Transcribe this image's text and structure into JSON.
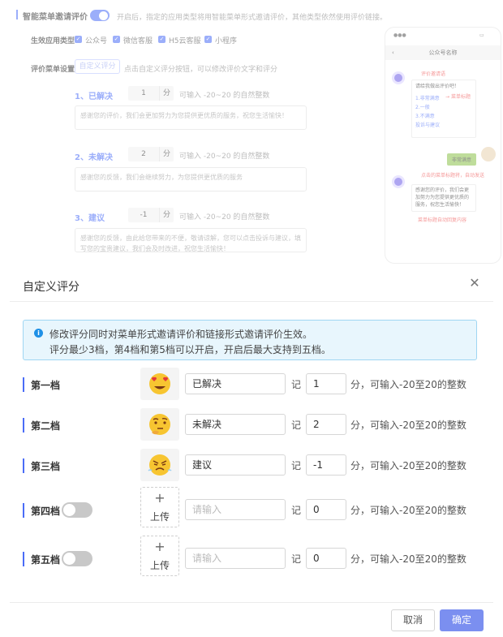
{
  "background_page": {
    "title": "智能菜单邀请评价",
    "title_hint": "开启后，指定的应用类型将用智能菜单形式邀请评价，其他类型依然使用评价链接。",
    "app_types_label": "生效应用类型",
    "app_types": [
      "公众号",
      "微信客服",
      "H5云客服",
      "小程序"
    ],
    "menu_settings_label": "评价菜单设置",
    "custom_score_button": "自定义评分",
    "custom_score_hint": "点击自定义评分按钮，可以修改评价文字和评分",
    "levels": [
      {
        "title": "1、已解决",
        "score": "1",
        "unit": "分",
        "hint": "可输入 -20~20 的自然整数",
        "message": "感谢您的评价，我们会更加努力为您提供更优质的服务，祝您生活愉快！"
      },
      {
        "title": "2、未解决",
        "score": "2",
        "unit": "分",
        "hint": "可输入 -20~20 的自然整数",
        "message": "感谢您的反馈，我们会继续努力，为您提供更优质的服务"
      },
      {
        "title": "3、建议",
        "score": "-1",
        "unit": "分",
        "hint": "可输入 -20~20 的自然整数",
        "message": "感谢您的反馈，由此给您带来的不便，敬请谅解，您可以点击投诉与建议，填写您的宝贵建议，我们会及时改进，祝您生活愉快！"
      }
    ],
    "phone": {
      "header": "公众号名称",
      "invite_label": "评价邀请语",
      "invite_text": "请给我做出评价吧！",
      "menu_title_label": "菜单标题",
      "options": [
        "1.非常满意",
        "2.一般",
        "3.不满意",
        "投诉与建议"
      ],
      "user_reply": "非常满意",
      "auto_send_note": "点击的菜单标题将，自动发送",
      "reply_text": "感谢您的评价，我们会更加努力为您提供更优质的服务，祝您生活愉快！",
      "reply_note": "菜单标题自动回复内容"
    }
  },
  "modal": {
    "title": "自定义评分",
    "notice_line1": "修改评分同时对菜单形式邀请评价和链接形式邀请评价生效。",
    "notice_line2": "评分最少3档，第4档和第5档可以开启，开启后最大支持到五档。",
    "tiers": [
      {
        "name": "第一档",
        "emoji": "heart-eyes",
        "label": "已解决",
        "score": "1"
      },
      {
        "name": "第二档",
        "emoji": "thinking",
        "label": "未解决",
        "score": "2"
      },
      {
        "name": "第三档",
        "emoji": "angry",
        "label": "建议",
        "score": "-1"
      },
      {
        "name": "第四档",
        "toggle_on": false,
        "upload": "上传",
        "placeholder": "请输入",
        "score": "0"
      },
      {
        "name": "第五档",
        "toggle_on": false,
        "upload": "上传",
        "placeholder": "请输入",
        "score": "0"
      }
    ],
    "ji_label": "记",
    "hint": "分，可输入-20至20的整数",
    "cancel": "取消",
    "confirm": "确定"
  },
  "colors": {
    "accent": "#4a6cf7",
    "notice_bg": "#e8f6fd",
    "confirm_bg": "#7b8ff0"
  }
}
